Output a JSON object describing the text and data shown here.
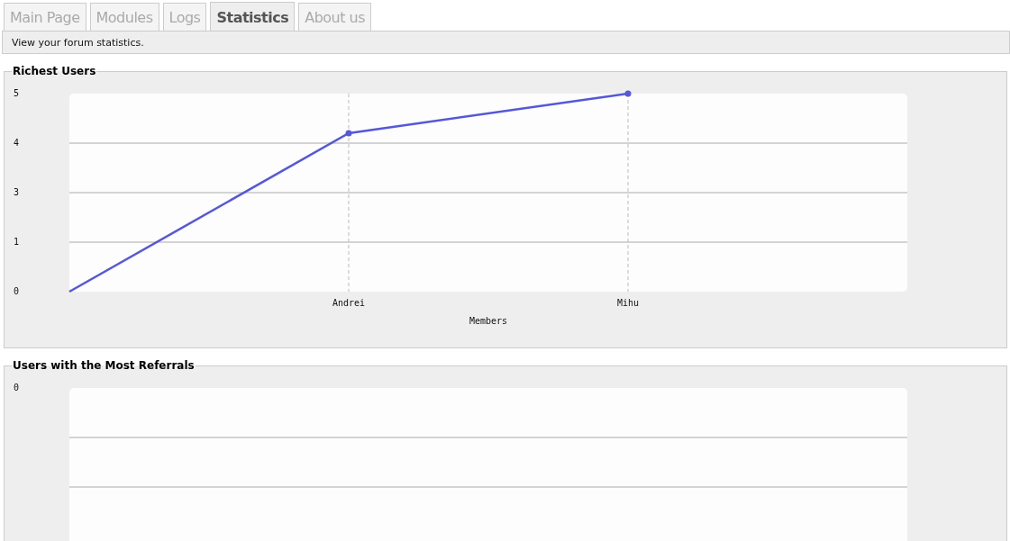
{
  "tabs": [
    {
      "label": "Main Page",
      "selected": false
    },
    {
      "label": "Modules",
      "selected": false
    },
    {
      "label": "Logs",
      "selected": false
    },
    {
      "label": "Statistics",
      "selected": true
    },
    {
      "label": "About us",
      "selected": false
    }
  ],
  "description": "View your forum statistics.",
  "richest_users": {
    "title": "Richest Users",
    "chart_data": {
      "type": "line",
      "grid": true,
      "xlabel": "Members",
      "categories": [
        null,
        "Andrei",
        "Mihu",
        null
      ],
      "ylim": [
        0,
        5
      ],
      "yticks": [
        {
          "value": 0,
          "label": "0"
        },
        {
          "value": 1.25,
          "label": "1"
        },
        {
          "value": 2.5,
          "label": "3"
        },
        {
          "value": 3.75,
          "label": "4"
        },
        {
          "value": 5,
          "label": "5"
        }
      ],
      "series": [
        {
          "color": "#5558d9",
          "values": [
            0,
            4,
            5,
            null
          ]
        }
      ]
    }
  },
  "most_referrals": {
    "title": "Users with the Most Referrals",
    "axis_label": "0"
  }
}
